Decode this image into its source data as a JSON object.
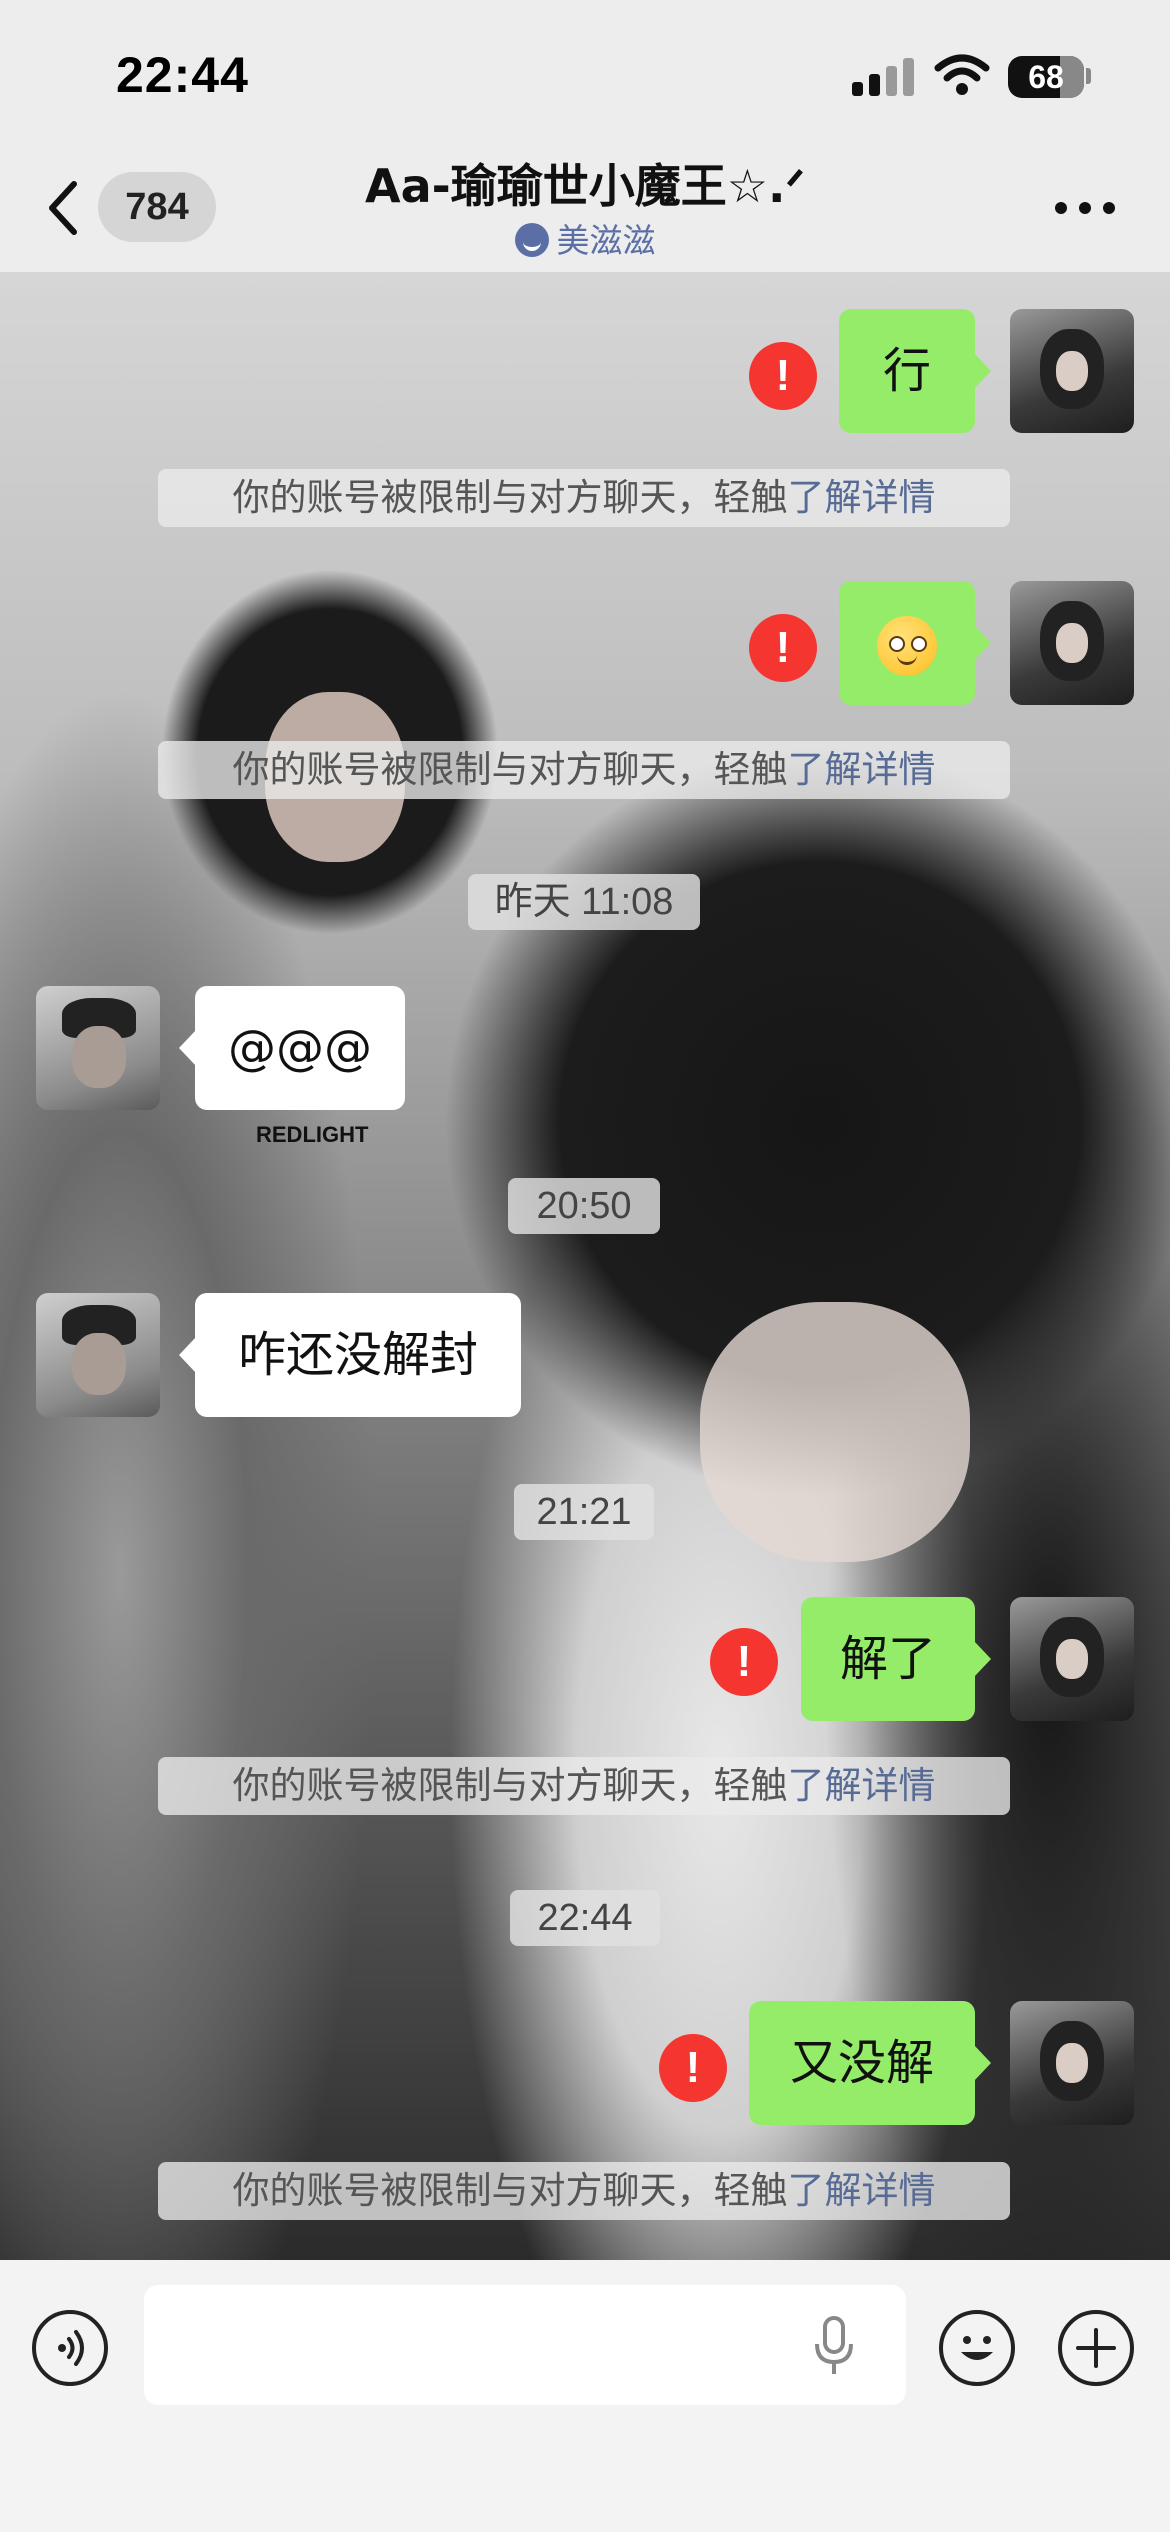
{
  "status_bar": {
    "time": "22:44",
    "battery": "68",
    "icons": [
      "cellular-signal-icon",
      "wifi-icon",
      "battery-icon"
    ]
  },
  "header": {
    "back_icon": "chevron-left-icon",
    "unread_count": "784",
    "title": "Aa-瑜瑜世小魔王☆.ᐟ",
    "subtitle": "美滋滋",
    "subtitle_icon": "status-smile-icon",
    "more_icon": "more-dots-icon"
  },
  "wallpaper": {
    "printed_text": "REDLIGHT"
  },
  "messages": [
    {
      "side": "self",
      "text": "行",
      "failed": true
    },
    {
      "type": "notice",
      "text": "你的账号被限制与对方聊天，轻触",
      "link": "了解详情"
    },
    {
      "side": "self",
      "emoji": "smile-emoji",
      "failed": true
    },
    {
      "type": "notice",
      "text": "你的账号被限制与对方聊天，轻触",
      "link": "了解详情"
    },
    {
      "type": "time",
      "text": "昨天 11:08"
    },
    {
      "side": "other",
      "text": "@@@"
    },
    {
      "type": "time",
      "text": "20:50"
    },
    {
      "side": "other",
      "text": "咋还没解封"
    },
    {
      "type": "time",
      "text": "21:21"
    },
    {
      "side": "self",
      "text": "解了",
      "failed": true
    },
    {
      "type": "notice",
      "text": "你的账号被限制与对方聊天，轻触",
      "link": "了解详情"
    },
    {
      "type": "time",
      "text": "22:44"
    },
    {
      "side": "self",
      "text": "又没解",
      "failed": true
    },
    {
      "type": "notice",
      "text": "你的账号被限制与对方聊天，轻触",
      "link": "了解详情"
    }
  ],
  "error_mark": "!",
  "input_bar": {
    "voice_icon": "voice-toggle-icon",
    "input_value": "",
    "mic_icon": "microphone-icon",
    "emoji_icon": "emoji-icon",
    "plus_icon": "plus-icon"
  },
  "colors": {
    "self_bubble": "#95ec69",
    "other_bubble": "#ffffff",
    "error_red": "#f43530",
    "link_blue": "#576b95"
  }
}
